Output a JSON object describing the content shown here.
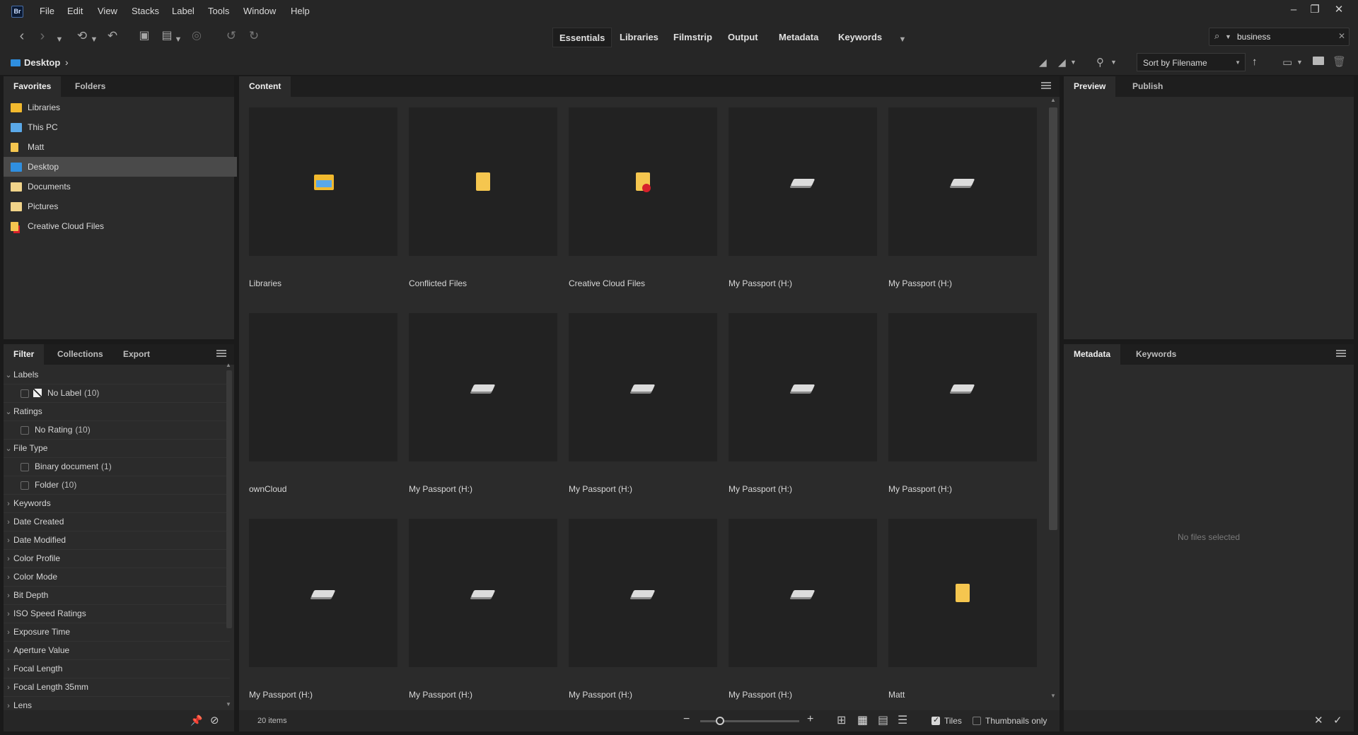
{
  "app": {
    "logo": "Br"
  },
  "menu": [
    "File",
    "Edit",
    "View",
    "Stacks",
    "Label",
    "Tools",
    "Window",
    "Help"
  ],
  "window_controls": {
    "minimize_icon": "minimize-icon",
    "restore_icon": "restore-icon",
    "close_icon": "close-icon"
  },
  "workspaces": [
    "Essentials",
    "Libraries",
    "Filmstrip",
    "Output",
    "Metadata",
    "Keywords"
  ],
  "active_workspace": "Essentials",
  "search": {
    "value": "business"
  },
  "path": {
    "location": "Desktop",
    "separator": "›"
  },
  "sort": {
    "label": "Sort by Filename"
  },
  "left_top_panel": {
    "tabs": [
      "Favorites",
      "Folders"
    ],
    "items": [
      {
        "label": "Libraries",
        "icon": "libraries-folder-icon",
        "color": "#f1b92e"
      },
      {
        "label": "This PC",
        "icon": "computer-icon",
        "color": "#5aa8e8"
      },
      {
        "label": "Matt",
        "icon": "user-folder-icon",
        "color": "#f5c64f"
      },
      {
        "label": "Desktop",
        "icon": "desktop-folder-icon",
        "color": "#2f8fe0"
      },
      {
        "label": "Documents",
        "icon": "documents-folder-icon",
        "color": "#f1d48a"
      },
      {
        "label": "Pictures",
        "icon": "pictures-folder-icon",
        "color": "#f1d48a"
      },
      {
        "label": "Creative Cloud Files",
        "icon": "cc-folder-icon",
        "color": "#f5c64f"
      }
    ],
    "selected": "Desktop"
  },
  "filter_panel": {
    "tabs": [
      "Filter",
      "Collections",
      "Export"
    ],
    "rows": [
      {
        "label": "Labels",
        "type": "group",
        "expanded": true
      },
      {
        "label": "No Label",
        "count": "(10)",
        "type": "check",
        "swatch": true
      },
      {
        "label": "Ratings",
        "type": "group",
        "expanded": true
      },
      {
        "label": "No Rating",
        "count": "(10)",
        "type": "check"
      },
      {
        "label": "File Type",
        "type": "group",
        "expanded": true
      },
      {
        "label": "Binary document",
        "count": "(1)",
        "type": "check"
      },
      {
        "label": "Folder",
        "count": "(10)",
        "type": "check"
      },
      {
        "label": "Keywords",
        "type": "group"
      },
      {
        "label": "Date Created",
        "type": "group"
      },
      {
        "label": "Date Modified",
        "type": "group"
      },
      {
        "label": "Color Profile",
        "type": "group"
      },
      {
        "label": "Color Mode",
        "type": "group"
      },
      {
        "label": "Bit Depth",
        "type": "group"
      },
      {
        "label": "ISO Speed Ratings",
        "type": "group"
      },
      {
        "label": "Exposure Time",
        "type": "group"
      },
      {
        "label": "Aperture Value",
        "type": "group"
      },
      {
        "label": "Focal Length",
        "type": "group"
      },
      {
        "label": "Focal Length 35mm",
        "type": "group"
      },
      {
        "label": "Lens",
        "type": "group"
      }
    ]
  },
  "content_panel": {
    "tab": "Content",
    "items": [
      {
        "label": "Libraries",
        "thumb": "libraries"
      },
      {
        "label": "Conflicted Files",
        "thumb": "folder"
      },
      {
        "label": "Creative Cloud Files",
        "thumb": "ccfolder"
      },
      {
        "label": "My Passport (H:)",
        "thumb": "drive"
      },
      {
        "label": "My Passport (H:)",
        "thumb": "drive"
      },
      {
        "label": "ownCloud",
        "thumb": "blank"
      },
      {
        "label": "My Passport (H:)",
        "thumb": "drive"
      },
      {
        "label": "My Passport (H:)",
        "thumb": "drive"
      },
      {
        "label": "My Passport (H:)",
        "thumb": "drive"
      },
      {
        "label": "My Passport (H:)",
        "thumb": "drive"
      },
      {
        "label": "My Passport (H:)",
        "thumb": "drive"
      },
      {
        "label": "My Passport (H:)",
        "thumb": "drive"
      },
      {
        "label": "My Passport (H:)",
        "thumb": "drive"
      },
      {
        "label": "My Passport (H:)",
        "thumb": "drive"
      },
      {
        "label": "Matt",
        "thumb": "folder"
      }
    ]
  },
  "status": {
    "item_count": "20 items",
    "tiles_label": "Tiles",
    "tiles_checked": true,
    "thumbnails_only_label": "Thumbnails only",
    "thumbnails_only_checked": false,
    "zoom_fraction": 0.2
  },
  "right_top_panel": {
    "tabs": [
      "Preview",
      "Publish"
    ]
  },
  "right_bottom_panel": {
    "tabs": [
      "Metadata",
      "Keywords"
    ],
    "empty_message": "No files selected"
  }
}
